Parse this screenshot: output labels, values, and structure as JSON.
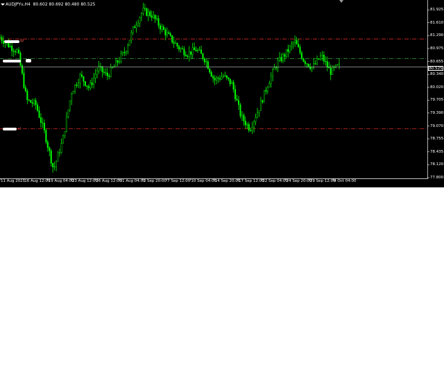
{
  "header": {
    "symbol_info": "AUDJPYv,H4  80.602 80.692 80.480 80.525"
  },
  "price_axis": {
    "ticks": [
      "81.925",
      "81.610",
      "81.290",
      "80.975",
      "80.655",
      "80.340",
      "80.020",
      "79.705",
      "79.390",
      "79.070",
      "78.755",
      "78.435",
      "78.120",
      "77.800"
    ],
    "current_price": "80.525"
  },
  "time_axis": {
    "labels": [
      "11 Aug 2021",
      "16 Aug 12:00",
      "19 Aug 04:00",
      "23 Aug 12:00",
      "26 Aug 12:00",
      "31 Aug 04:00",
      "2 Sep 20:00",
      "7 Sep 12:00",
      "10 Sep 04:00",
      "14 Sep 20:00",
      "17 Sep 12:00",
      "22 Sep 04:00",
      "24 Sep 20:00",
      "29 Sep 12:00",
      "4 Oct 04:00"
    ]
  },
  "levels": {
    "tp_price": 81.21,
    "entry_price": 80.73,
    "sl_price": 79.0,
    "tp_tag": "tp",
    "sl_tag": "sl",
    "tp_color": "#ff3030",
    "entry_color": "#40c040",
    "sl_color": "#ff3030"
  },
  "colors": {
    "background": "#000000",
    "candle": "#00ff00",
    "axis_text": "#ffffff",
    "grid_line": "#ffffff"
  },
  "chart_data": {
    "type": "candlestick",
    "symbol": "AUDJPYv",
    "timeframe": "H4",
    "ylim": [
      77.8,
      82.1
    ],
    "close_path": [
      {
        "t": "11 Aug 2021",
        "price": 81.25
      },
      {
        "t": "12 Aug",
        "price": 81.05
      },
      {
        "t": "13 Aug",
        "price": 80.9
      },
      {
        "t": "16 Aug 12:00",
        "price": 79.7
      },
      {
        "t": "17 Aug",
        "price": 79.6
      },
      {
        "t": "18 Aug",
        "price": 78.9
      },
      {
        "t": "19 Aug 04:00",
        "price": 78.0
      },
      {
        "t": "20 Aug",
        "price": 78.7
      },
      {
        "t": "23 Aug 12:00",
        "price": 79.9
      },
      {
        "t": "24 Aug",
        "price": 80.3
      },
      {
        "t": "25 Aug",
        "price": 80.0
      },
      {
        "t": "26 Aug 12:00",
        "price": 80.5
      },
      {
        "t": "27 Aug",
        "price": 80.3
      },
      {
        "t": "30 Aug",
        "price": 80.6
      },
      {
        "t": "31 Aug 04:00",
        "price": 80.9
      },
      {
        "t": "1 Sep",
        "price": 81.5
      },
      {
        "t": "2 Sep 20:00",
        "price": 81.9
      },
      {
        "t": "3 Sep",
        "price": 81.8
      },
      {
        "t": "6 Sep",
        "price": 81.5
      },
      {
        "t": "7 Sep 12:00",
        "price": 81.25
      },
      {
        "t": "8 Sep",
        "price": 81.0
      },
      {
        "t": "9 Sep",
        "price": 80.85
      },
      {
        "t": "10 Sep 04:00",
        "price": 80.95
      },
      {
        "t": "13 Sep",
        "price": 80.7
      },
      {
        "t": "14 Sep 20:00",
        "price": 80.2
      },
      {
        "t": "15 Sep",
        "price": 80.3
      },
      {
        "t": "16 Sep",
        "price": 80.1
      },
      {
        "t": "17 Sep 12:00",
        "price": 79.3
      },
      {
        "t": "20 Sep",
        "price": 79.0
      },
      {
        "t": "21 Sep",
        "price": 79.5
      },
      {
        "t": "22 Sep 04:00",
        "price": 80.1
      },
      {
        "t": "23 Sep",
        "price": 80.6
      },
      {
        "t": "24 Sep 20:00",
        "price": 80.85
      },
      {
        "t": "27 Sep",
        "price": 81.15
      },
      {
        "t": "28 Sep",
        "price": 80.7
      },
      {
        "t": "29 Sep 12:00",
        "price": 80.5
      },
      {
        "t": "30 Sep",
        "price": 80.8
      },
      {
        "t": "1 Oct",
        "price": 80.4
      },
      {
        "t": "4 Oct 04:00",
        "price": 80.55
      }
    ]
  }
}
